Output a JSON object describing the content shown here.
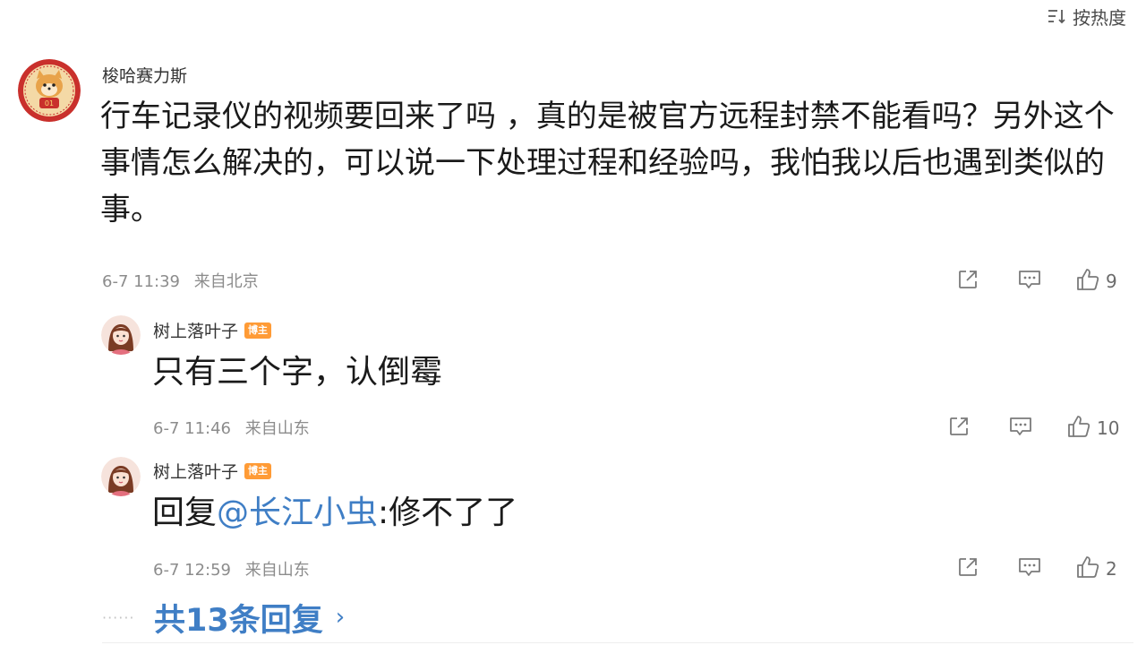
{
  "sort": {
    "label": "按热度"
  },
  "comments": [
    {
      "user": "梭哈赛力斯",
      "content": "行车记录仪的视频要回来了吗 ，真的是被官方远程封禁不能看吗？另外这个事情怎么解决的，可以说一下处理过程和经验吗，我怕我以后也遇到类似的事。",
      "date": "6-7 11:39",
      "location": "来自北京",
      "likes": "9"
    },
    {
      "user": "树上落叶子",
      "badge": "博主",
      "content": "只有三个字，认倒霉",
      "date": "6-7 11:46",
      "location": "来自山东",
      "likes": "10"
    },
    {
      "user": "树上落叶子",
      "badge": "博主",
      "content_prefix": "回复",
      "mention": "@长江小虫",
      "content_suffix": ":修不了了",
      "date": "6-7 12:59",
      "location": "来自山东",
      "likes": "2"
    }
  ],
  "more_replies": {
    "label": "共13条回复",
    "dots": "······",
    "arrow": "›"
  },
  "icons": {
    "share": "share-icon",
    "reply": "comment-icon",
    "like": "thumbs-up-icon",
    "sort": "sort-icon"
  },
  "colors": {
    "link": "#3f7ec5",
    "badge": "#ff9b36",
    "meta": "#8c8c8c"
  }
}
